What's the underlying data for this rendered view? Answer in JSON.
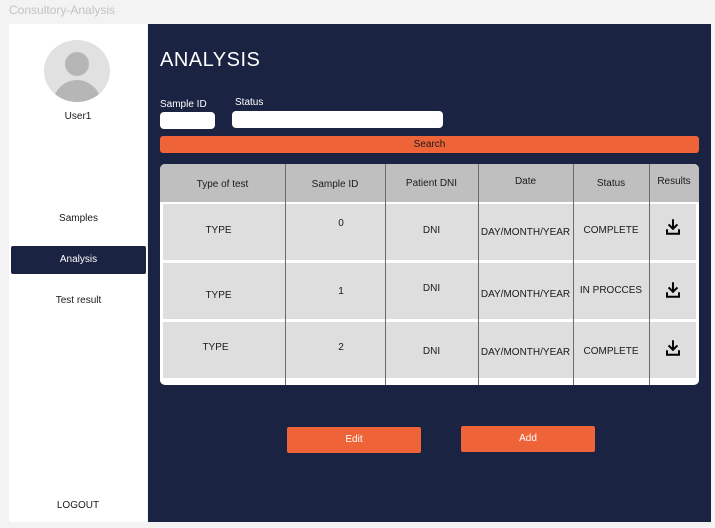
{
  "window": {
    "title": "Consultory-Analysis"
  },
  "sidebar": {
    "user": "User1",
    "items": [
      {
        "label": "Samples",
        "active": false
      },
      {
        "label": "Analysis",
        "active": true
      },
      {
        "label": "Test result",
        "active": false
      }
    ],
    "logout": "LOGOUT"
  },
  "main": {
    "title": "ANALYSIS",
    "filters": {
      "sample_id_label": "Sample ID",
      "sample_id_value": "",
      "status_label": "Status",
      "status_value": ""
    },
    "search_label": "Search",
    "table": {
      "columns": [
        "Type of test",
        "Sample ID",
        "Patient DNI",
        "Date",
        "Status",
        "Results"
      ],
      "rows": [
        {
          "type": "TYPE",
          "sample_id": "0",
          "dni": "DNI",
          "date": "DAY/MONTH/YEAR",
          "status": "COMPLETE",
          "result_icon": "download-icon"
        },
        {
          "type": "TYPE",
          "sample_id": "1",
          "dni": "DNI",
          "date": "DAY/MONTH/YEAR",
          "status": "IN PROCCES",
          "result_icon": "download-icon"
        },
        {
          "type": "TYPE",
          "sample_id": "2",
          "dni": "DNI",
          "date": "DAY/MONTH/YEAR",
          "status": "COMPLETE",
          "result_icon": "download-icon"
        }
      ]
    },
    "edit_label": "Edit",
    "add_label": "Add"
  },
  "colors": {
    "navy": "#1a2342",
    "accent": "#ee6338",
    "header_gray": "#bfbfbf",
    "row_gray": "#dedede"
  }
}
